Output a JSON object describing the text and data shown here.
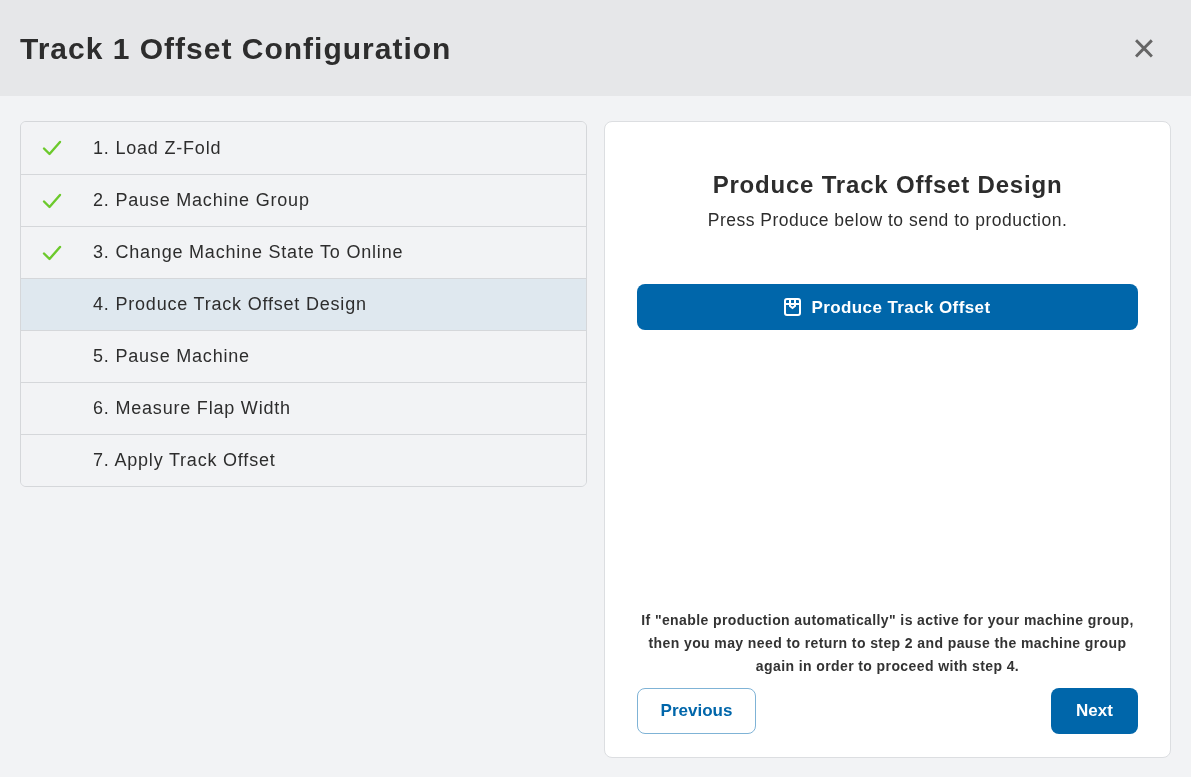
{
  "dialog": {
    "title": "Track 1 Offset Configuration",
    "close": "×"
  },
  "steps": [
    {
      "label": "1. Load Z-Fold",
      "completed": true,
      "selected": false
    },
    {
      "label": "2. Pause Machine Group",
      "completed": true,
      "selected": false
    },
    {
      "label": "3. Change Machine State To Online",
      "completed": true,
      "selected": false
    },
    {
      "label": "4. Produce Track Offset Design",
      "completed": false,
      "selected": true
    },
    {
      "label": "5. Pause Machine",
      "completed": false,
      "selected": false
    },
    {
      "label": "6. Measure Flap Width",
      "completed": false,
      "selected": false
    },
    {
      "label": "7. Apply Track Offset",
      "completed": false,
      "selected": false
    }
  ],
  "panel": {
    "heading": "Produce Track Offset Design",
    "subtitle": "Press Produce below to send to production.",
    "action_button": "Produce Track Offset",
    "note": "If \"enable production automatically\" is active for your machine group, then you may need to return to step 2 and pause the machine group again in order to proceed with step 4.",
    "previous_button": "Previous",
    "next_button": "Next"
  }
}
